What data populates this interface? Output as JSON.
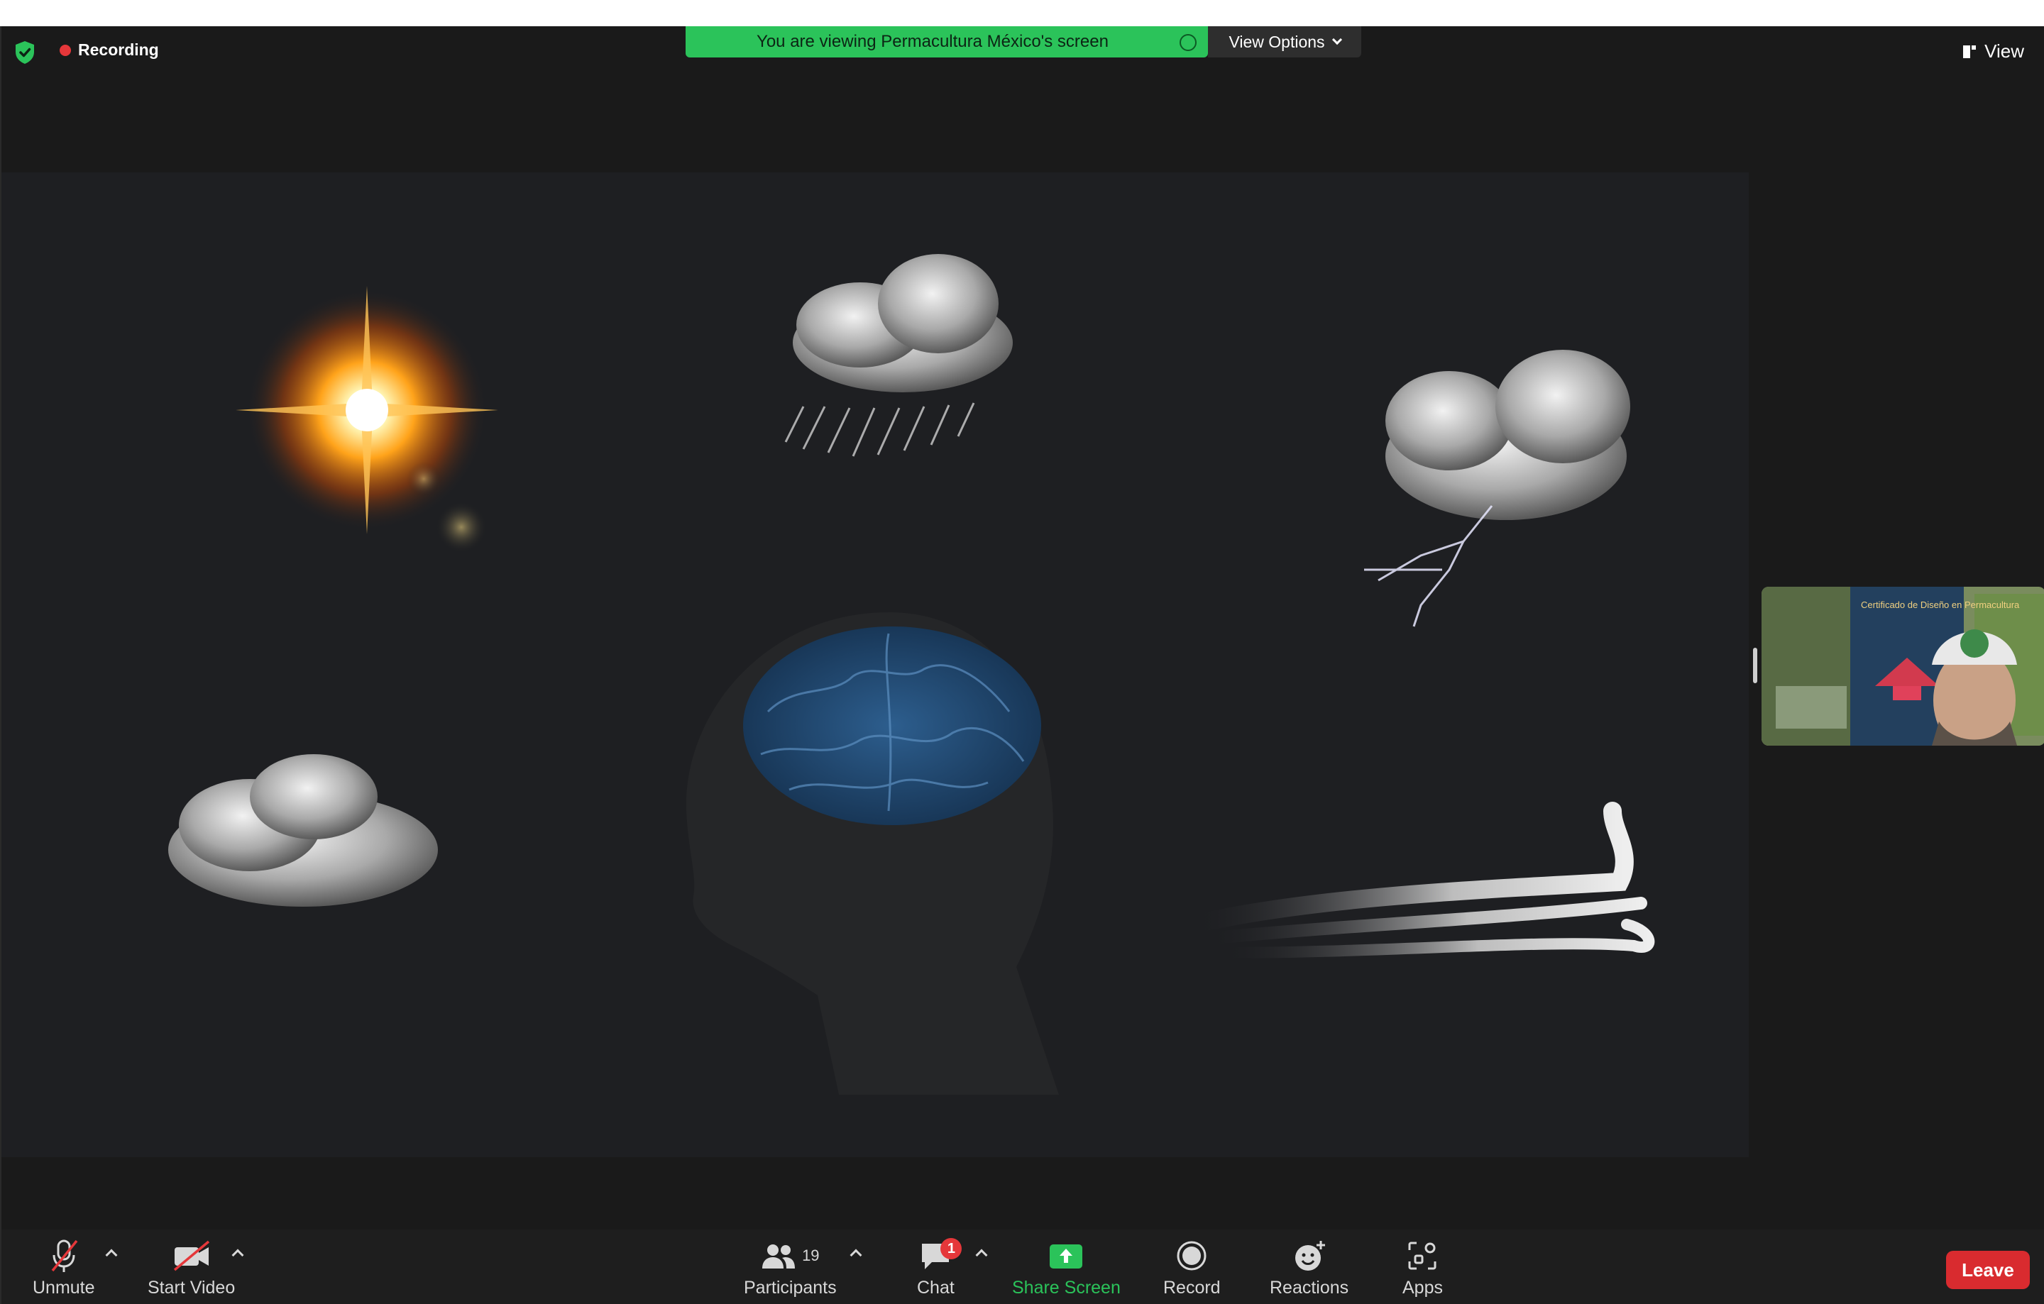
{
  "top_bar": {
    "recording_label": "Recording",
    "viewing_banner": "You are viewing Permacultura México's screen",
    "view_options_label": "View Options",
    "view_label": "View"
  },
  "participant_thumbnail": {
    "poster_text": "Certificado de Diseño en Permacultura"
  },
  "toolbar": {
    "unmute_label": "Unmute",
    "start_video_label": "Start Video",
    "participants_label": "Participants",
    "participants_count": "19",
    "chat_label": "Chat",
    "chat_badge": "1",
    "share_screen_label": "Share Screen",
    "record_label": "Record",
    "reactions_label": "Reactions",
    "apps_label": "Apps",
    "leave_label": "Leave"
  },
  "colors": {
    "accent_green": "#2bc35a",
    "leave_red": "#d92b2f",
    "recording_red": "#e5373a",
    "background": "#1a1a1a"
  },
  "icons": [
    "shield-check-icon",
    "recording-dot-icon",
    "view-icon",
    "muted-microphone-icon",
    "video-off-icon",
    "participants-icon",
    "chat-bubble-icon",
    "share-screen-icon",
    "record-icon",
    "reactions-icon",
    "apps-icon"
  ]
}
